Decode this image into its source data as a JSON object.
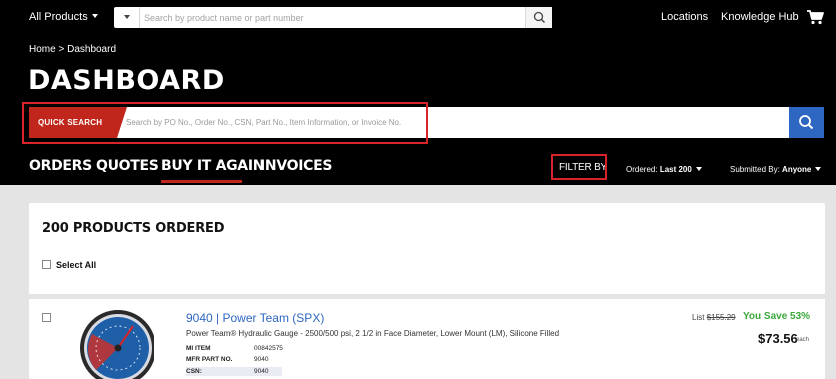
{
  "topbar": {
    "all_products": "All Products",
    "search_placeholder": "Search by product name or part number",
    "locations": "Locations",
    "knowledge_hub": "Knowledge Hub"
  },
  "breadcrumb": {
    "home": "Home",
    "separator": ">",
    "current": "Dashboard"
  },
  "page_title": "DASHBOARD",
  "quick_search": {
    "label": "QUICK SEARCH",
    "placeholder": "Search by PO No., Order No., CSN, Part No., Item Information, or Invoice No."
  },
  "tabs": [
    {
      "label": "ORDERS",
      "active": false
    },
    {
      "label": "QUOTES",
      "active": false
    },
    {
      "label": "BUY IT AGAIN",
      "active": true
    },
    {
      "label": "INVOICES",
      "active": false
    }
  ],
  "filters": {
    "filter_by": "FILTER BY",
    "ordered_label": "Ordered:",
    "ordered_value": "Last 200",
    "submitted_label": "Submitted By:",
    "submitted_value": "Anyone"
  },
  "products": {
    "count_title": "200 PRODUCTS ORDERED",
    "select_all": "Select All",
    "items": [
      {
        "part": "9040",
        "brand": "Power Team (SPX)",
        "title_separator": " | ",
        "description": "Power Team® Hydraulic Gauge - 2500/500 psi, 2 1/2 in Face Diameter, Lower Mount (LM), Silicone Filled",
        "specs": [
          {
            "label": "MI ITEM",
            "value": "00842575"
          },
          {
            "label": "MFR PART NO.",
            "value": "9040"
          },
          {
            "label": "CSN:",
            "value": "9040"
          }
        ],
        "list_label": "List",
        "list_price": "$155.29",
        "you_save": "You Save 53%",
        "price": "$73.56",
        "unit": "each"
      }
    ]
  },
  "colors": {
    "brand_red": "#c0261b",
    "accent_blue": "#2e67c2",
    "save_green": "#3aa83a",
    "highlight_red": "#d8232a"
  }
}
